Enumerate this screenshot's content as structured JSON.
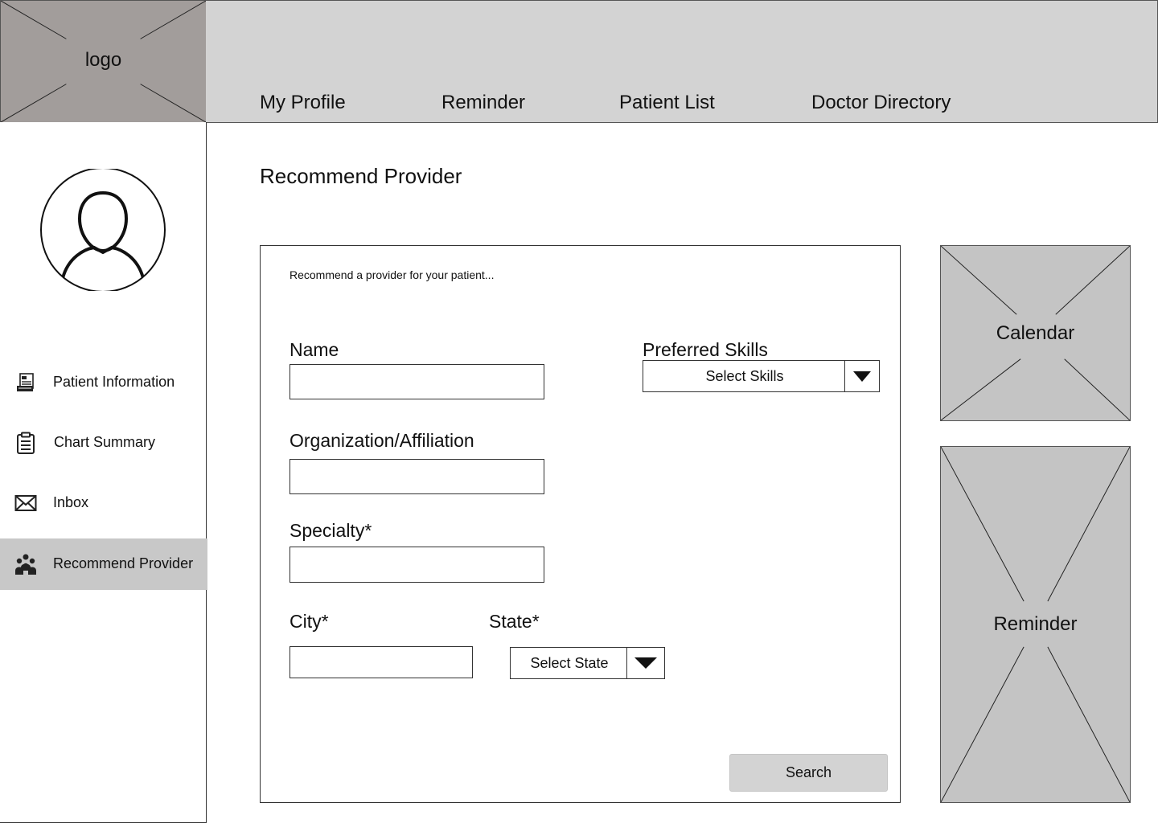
{
  "logo": {
    "label": "logo"
  },
  "nav": {
    "items": [
      {
        "label": "My Profile"
      },
      {
        "label": "Reminder"
      },
      {
        "label": "Patient List"
      },
      {
        "label": "Doctor Directory"
      }
    ]
  },
  "sidebar": {
    "items": [
      {
        "label": "Patient Information",
        "icon": "patient-info-icon"
      },
      {
        "label": "Chart Summary",
        "icon": "clipboard-icon"
      },
      {
        "label": "Inbox",
        "icon": "envelope-icon"
      },
      {
        "label": "Recommend Provider",
        "icon": "people-group-icon",
        "active": true
      }
    ]
  },
  "main": {
    "title": "Recommend Provider",
    "form": {
      "intro": "Recommend a provider for your patient...",
      "name_label": "Name",
      "name_value": "",
      "org_label": "Organization/Affiliation",
      "org_value": "",
      "specialty_label": "Specialty*",
      "specialty_value": "",
      "city_label": "City*",
      "city_value": "",
      "state_label": "State*",
      "state_select": "Select State",
      "skills_label": "Preferred Skills",
      "skills_select": "Select Skills",
      "search_button": "Search"
    }
  },
  "widgets": {
    "calendar": "Calendar",
    "reminder": "Reminder"
  },
  "colors": {
    "logo_bg": "#a29d9b",
    "header_bg": "#d3d3d3",
    "active_item_bg": "#c8c8c8",
    "placeholder_bg": "#c4c4c4",
    "button_bg": "#d3d3d3"
  }
}
